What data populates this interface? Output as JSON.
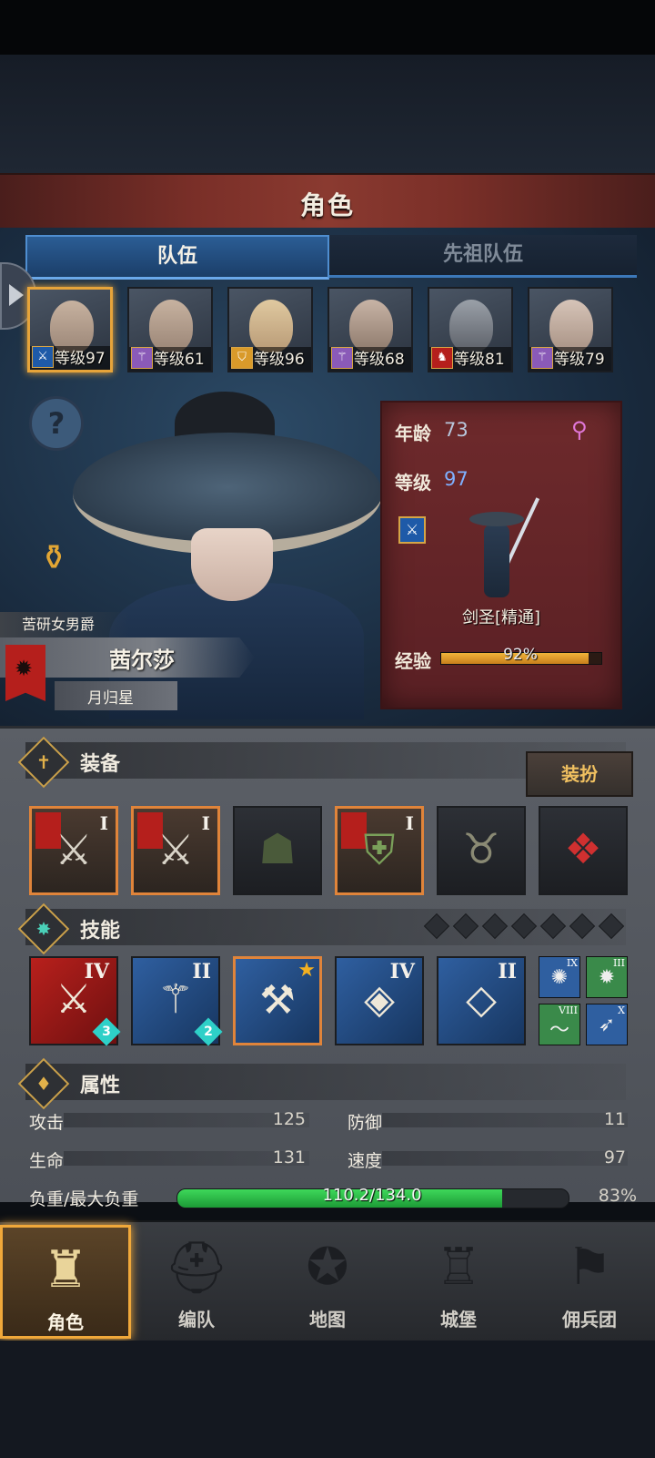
{
  "header": {
    "title": "角色"
  },
  "tabs": [
    {
      "label": "队伍",
      "active": true
    },
    {
      "label": "先祖队伍",
      "active": false
    }
  ],
  "party": [
    {
      "level_text": "等级97",
      "class_icon": "sword-icon",
      "selected": true
    },
    {
      "level_text": "等级61",
      "class_icon": "staff-icon",
      "selected": false
    },
    {
      "level_text": "等级96",
      "class_icon": "shield-icon",
      "selected": false
    },
    {
      "level_text": "等级68",
      "class_icon": "staff-icon",
      "selected": false
    },
    {
      "level_text": "等级81",
      "class_icon": "horse-icon",
      "selected": false
    },
    {
      "level_text": "等级79",
      "class_icon": "staff-icon",
      "selected": false
    }
  ],
  "hero": {
    "title": "苦研女男爵",
    "name": "茜尔莎",
    "subname": "月归星"
  },
  "info_card": {
    "age_label": "年龄",
    "age": "73",
    "level_label": "等级",
    "level": "97",
    "class_name": "剑圣[精通]",
    "exp_label": "经验",
    "exp_text": "92%",
    "exp_fraction": 0.92
  },
  "equipment": {
    "title": "装备",
    "dress_button": "装扮",
    "slots": [
      {
        "item": "weapon-icon",
        "tier": "I",
        "highlight": true
      },
      {
        "item": "weapon-icon",
        "tier": "I",
        "highlight": true
      },
      {
        "item": "hood-icon",
        "tier": "",
        "highlight": false
      },
      {
        "item": "armor-icon",
        "tier": "I",
        "highlight": true
      },
      {
        "item": "boots-icon",
        "tier": "",
        "highlight": false
      },
      {
        "item": "knot-charm-icon",
        "tier": "",
        "highlight": false
      }
    ]
  },
  "skills": {
    "title": "技能",
    "slot_count": 7,
    "items": [
      {
        "tier": "IV",
        "badge": "3",
        "color": "red"
      },
      {
        "tier": "II",
        "badge": "2",
        "color": "blue"
      },
      {
        "tier": "",
        "badge": "",
        "color": "blue",
        "starred": true
      },
      {
        "tier": "IV",
        "badge": "",
        "color": "blue"
      },
      {
        "tier": "II",
        "badge": "",
        "color": "blue"
      }
    ],
    "minis": [
      {
        "tier": "IX",
        "color": "blue"
      },
      {
        "tier": "III",
        "color": "green"
      },
      {
        "tier": "VIII",
        "color": "green"
      },
      {
        "tier": "X",
        "color": "blue"
      }
    ]
  },
  "attributes": {
    "title": "属性",
    "attack_label": "攻击",
    "attack": "125",
    "defense_label": "防御",
    "defense": "11",
    "hp_label": "生命",
    "hp": "131",
    "speed_label": "速度",
    "speed": "97",
    "load_label": "负重/最大负重",
    "load_text": "110.2/134.0",
    "load_percent": "83%",
    "load_fraction": 0.83
  },
  "nav": [
    {
      "label": "角色",
      "icon": "knight-icon",
      "active": true
    },
    {
      "label": "编队",
      "icon": "helmet-icon",
      "active": false
    },
    {
      "label": "地图",
      "icon": "compass-map-icon",
      "active": false
    },
    {
      "label": "城堡",
      "icon": "castle-icon",
      "active": false
    },
    {
      "label": "佣兵团",
      "icon": "banner-icon",
      "active": false
    }
  ],
  "colors": {
    "accent_gold": "#e6a43a",
    "tab_blue": "#2b5d95",
    "card_red": "#6e2a2c",
    "load_green": "#3ed85a"
  }
}
